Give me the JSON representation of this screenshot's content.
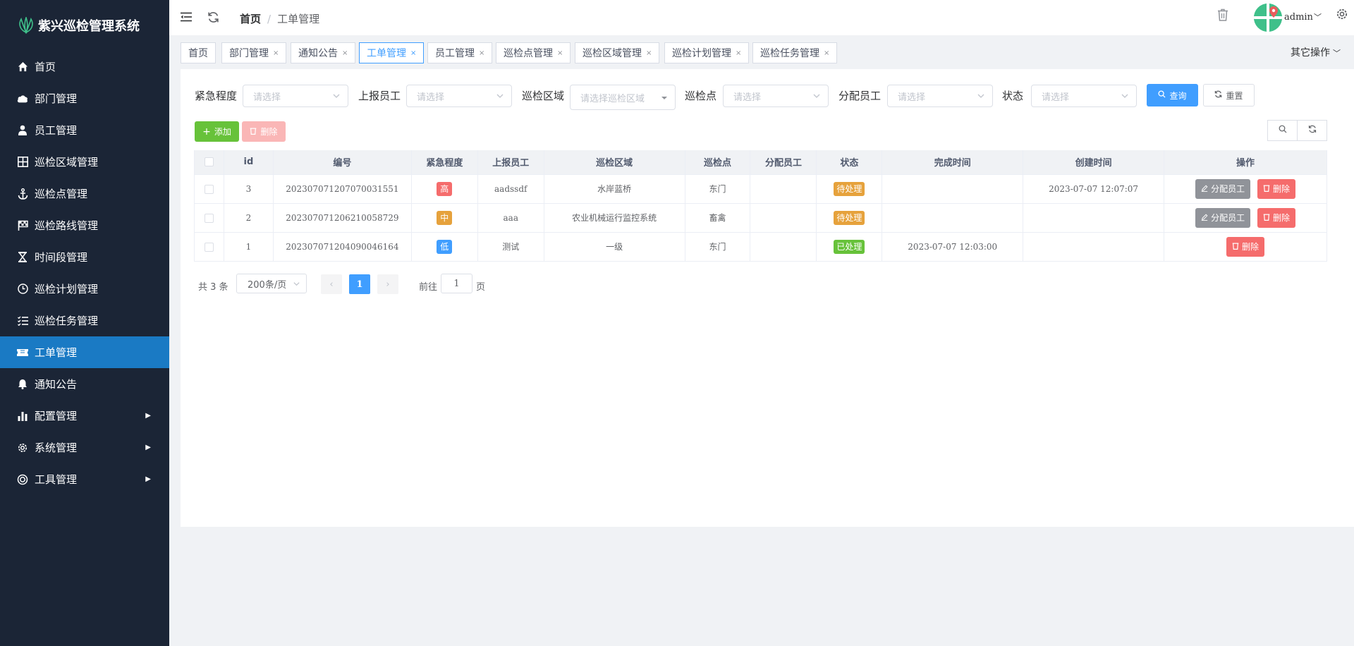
{
  "app": {
    "title": "紫兴巡检管理系统"
  },
  "sidebar": {
    "items": [
      {
        "label": "首页",
        "icon": "home-icon"
      },
      {
        "label": "部门管理",
        "icon": "cloud-icon"
      },
      {
        "label": "员工管理",
        "icon": "user-icon"
      },
      {
        "label": "巡检区域管理",
        "icon": "grid-icon"
      },
      {
        "label": "巡检点管理",
        "icon": "anchor-icon"
      },
      {
        "label": "巡检路线管理",
        "icon": "flag-icon"
      },
      {
        "label": "时间段管理",
        "icon": "hourglass-icon"
      },
      {
        "label": "巡检计划管理",
        "icon": "clock-icon"
      },
      {
        "label": "巡检任务管理",
        "icon": "list-icon"
      },
      {
        "label": "工单管理",
        "icon": "ticket-icon",
        "active": true
      },
      {
        "label": "通知公告",
        "icon": "bell-icon"
      },
      {
        "label": "配置管理",
        "icon": "bar-chart-icon",
        "has_children": true
      },
      {
        "label": "系统管理",
        "icon": "gear-icon",
        "has_children": true
      },
      {
        "label": "工具管理",
        "icon": "target-icon",
        "has_children": true
      }
    ]
  },
  "header": {
    "breadcrumb_home": "首页",
    "breadcrumb_sep": "/",
    "breadcrumb_current": "工单管理",
    "username": "admin"
  },
  "tags": {
    "items": [
      {
        "label": "首页",
        "closable": false
      },
      {
        "label": "部门管理",
        "closable": true
      },
      {
        "label": "通知公告",
        "closable": true
      },
      {
        "label": "工单管理",
        "closable": true,
        "active": true
      },
      {
        "label": "员工管理",
        "closable": true
      },
      {
        "label": "巡检点管理",
        "closable": true
      },
      {
        "label": "巡检区域管理",
        "closable": true
      },
      {
        "label": "巡检计划管理",
        "closable": true
      },
      {
        "label": "巡检任务管理",
        "closable": true
      }
    ],
    "close_glyph": "×",
    "other_ops": "其它操作"
  },
  "filters": {
    "urgency": {
      "label": "紧急程度",
      "placeholder": "请选择"
    },
    "reporter": {
      "label": "上报员工",
      "placeholder": "请选择"
    },
    "area": {
      "label": "巡检区域",
      "placeholder": "请选择巡检区域"
    },
    "point": {
      "label": "巡检点",
      "placeholder": "请选择"
    },
    "assignee": {
      "label": "分配员工",
      "placeholder": "请选择"
    },
    "status": {
      "label": "状态",
      "placeholder": "请选择"
    },
    "query_label": "查询",
    "reset_label": "重置"
  },
  "toolbar": {
    "add_label": "添加",
    "delete_label": "删除"
  },
  "table": {
    "columns": [
      "",
      "id",
      "编号",
      "紧急程度",
      "上报员工",
      "巡检区域",
      "巡检点",
      "分配员工",
      "状态",
      "完成时间",
      "创建时间",
      "操作"
    ],
    "rows": [
      {
        "id": "3",
        "code": "20230707120707003155​1",
        "urgency": "高",
        "urgency_level": "high",
        "reporter": "aadssdf",
        "area": "水岸蓝桥",
        "point": "东门",
        "assignee": "",
        "status": "待处理",
        "status_type": "pending",
        "finished": "",
        "created": "2023-07-07 12:07:07",
        "actions": [
          "分配员工",
          "删除"
        ]
      },
      {
        "id": "2",
        "code": "20230707120621005872​9",
        "urgency": "中",
        "urgency_level": "mid",
        "reporter": "aaa",
        "area": "农业机械运行监控系统",
        "point": "畜禽",
        "assignee": "",
        "status": "待处理",
        "status_type": "pending",
        "finished": "",
        "created": "",
        "actions": [
          "分配员工",
          "删除"
        ]
      },
      {
        "id": "1",
        "code": "20230707120409004616​4",
        "urgency": "低",
        "urgency_level": "low",
        "reporter": "测试",
        "area": "一级",
        "point": "东门",
        "assignee": "",
        "status": "已处理",
        "status_type": "done",
        "finished": "2023-07-07 12:03:00",
        "created": "",
        "actions": [
          "删除"
        ]
      }
    ]
  },
  "pagination": {
    "total_text": "共 3 条",
    "page_size": "200条/页",
    "current_page": "1",
    "goto_prefix": "前往",
    "goto_value": "1",
    "goto_suffix": "页"
  },
  "colors": {
    "sidebar_bg": "#1b2536",
    "active_menu": "#1a7ac4",
    "primary": "#409eff",
    "success": "#67c23a",
    "warning": "#e6a23c",
    "danger": "#f56c6c",
    "info": "#909399"
  }
}
